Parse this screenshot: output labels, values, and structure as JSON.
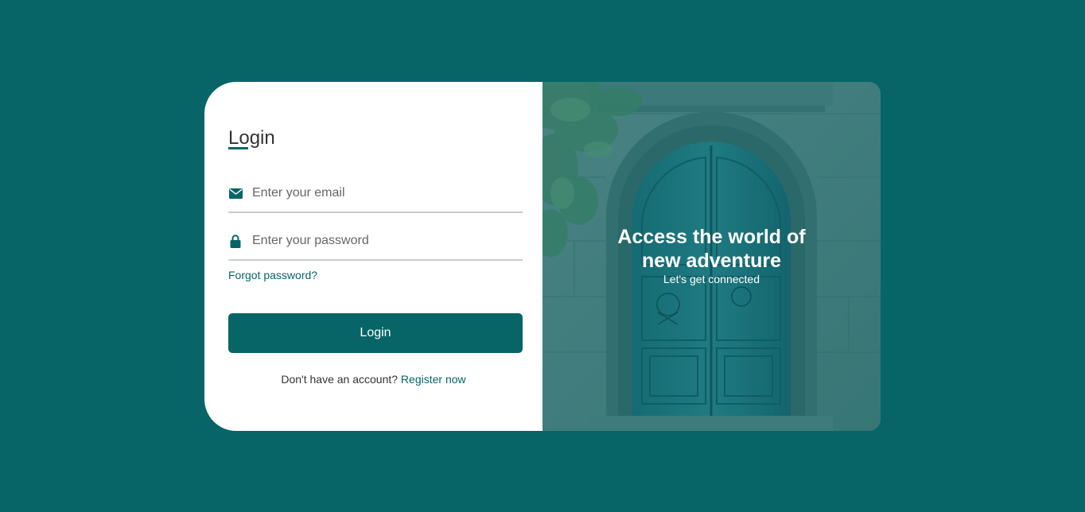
{
  "login_form": {
    "title": "Login",
    "email_placeholder": "Enter your email",
    "password_placeholder": "Enter your password",
    "forgot_password_label": "Forgot password?",
    "submit_label": "Login",
    "register_prompt": "Don't have an account?",
    "register_link_label": "Register now"
  },
  "hero": {
    "title_line1": "Access the world of",
    "title_line2": "new adventure",
    "subtitle": "Let's get connected"
  },
  "icons": {
    "email": "envelope-icon",
    "password": "lock-icon"
  },
  "colors": {
    "background": "#076567",
    "accent": "#076567",
    "panel": "#ffffff"
  }
}
